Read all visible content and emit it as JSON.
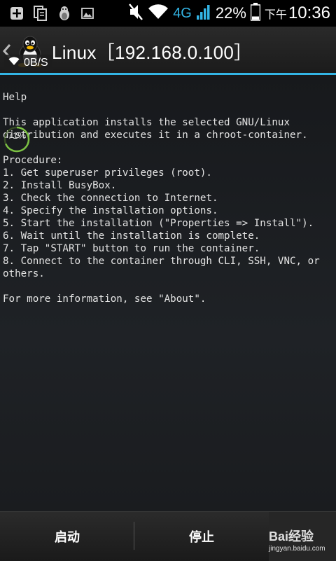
{
  "status_bar": {
    "network": "4G",
    "battery_percent": "22%",
    "clock_prefix": "下午",
    "clock_time": "10:36",
    "icons": [
      "add-notification-icon",
      "copy-notification-icon",
      "linux-deploy-notification-icon",
      "image-notification-icon",
      "muted-speaker-icon",
      "wifi-icon",
      "signal-icon",
      "battery-icon"
    ]
  },
  "action_bar": {
    "title": "Linux［192.168.0.100］",
    "speed": "0B/S",
    "accent_color": "#33b5e5"
  },
  "content": {
    "progress_label": "71%",
    "help_text": "Help\n\nThis application installs the selected GNU/Linux\ndistribution and executes it in a chroot-container.\n\nProcedure:\n1. Get superuser privileges (root).\n2. Install BusyBox.\n3. Check the connection to Internet.\n4. Specify the installation options.\n5. Start the installation (\"Properties => Install\").\n6. Wait until the installation is complete.\n7. Tap \"START\" button to run the container.\n8. Connect to the container through CLI, SSH, VNC, or\nothers.\n\nFor more information, see \"About\"."
  },
  "bottom_bar": {
    "start_label": "启动",
    "stop_label": "停止"
  },
  "watermark": {
    "brand": "Bai经验",
    "url": "jingyan.baidu.com"
  }
}
